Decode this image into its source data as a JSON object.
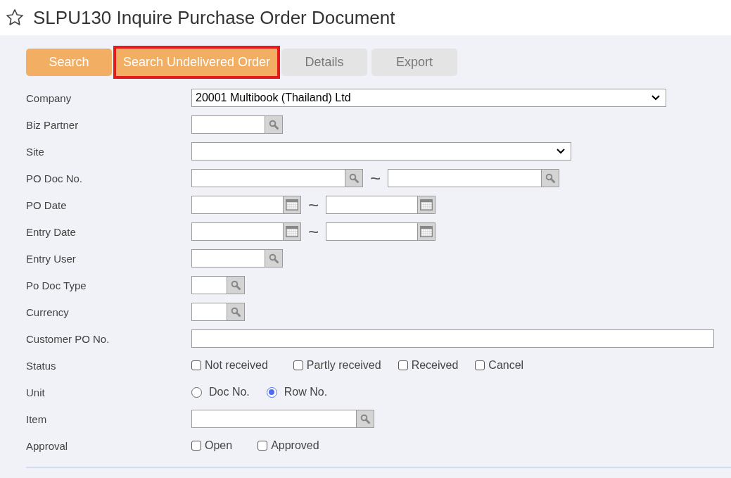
{
  "page": {
    "title": "SLPU130 Inquire Purchase Order Document",
    "favorite": false
  },
  "buttons": [
    {
      "label": "Search",
      "disabled": false,
      "highlighted": false
    },
    {
      "label": "Search Undelivered Order",
      "disabled": false,
      "highlighted": true
    },
    {
      "label": "Details",
      "disabled": true,
      "highlighted": false
    },
    {
      "label": "Export",
      "disabled": true,
      "highlighted": false
    }
  ],
  "fields": [
    {
      "label": "Company",
      "kind": "select",
      "value": "20001 Multibook (Thailand) Ltd"
    },
    {
      "label": "Biz Partner",
      "kind": "lookup"
    },
    {
      "label": "Site",
      "kind": "select"
    },
    {
      "label": "PO Doc No.",
      "kind": "lookup_range",
      "separator": "~"
    },
    {
      "label": "PO Date",
      "kind": "date_range",
      "separator": "~"
    },
    {
      "label": "Entry Date",
      "kind": "date_range",
      "separator": "~"
    },
    {
      "label": "Entry User",
      "kind": "lookup"
    },
    {
      "label": "Po Doc Type",
      "kind": "lookup"
    },
    {
      "label": "Currency",
      "kind": "lookup"
    },
    {
      "label": "Customer PO No.",
      "kind": "text"
    },
    {
      "label": "Status",
      "kind": "checkboxes",
      "options": [
        {
          "label": "Not received",
          "checked": false
        },
        {
          "label": "Partly received",
          "checked": false
        },
        {
          "label": "Received",
          "checked": false
        },
        {
          "label": "Cancel",
          "checked": false
        }
      ]
    },
    {
      "label": "Unit",
      "kind": "radios",
      "options": [
        {
          "label": "Doc No.",
          "selected": false
        },
        {
          "label": "Row No.",
          "selected": true
        }
      ]
    },
    {
      "label": "Item",
      "kind": "lookup"
    },
    {
      "label": "Approval",
      "kind": "checkboxes",
      "options": [
        {
          "label": "Open",
          "checked": false
        },
        {
          "label": "Approved",
          "checked": false
        }
      ]
    }
  ]
}
